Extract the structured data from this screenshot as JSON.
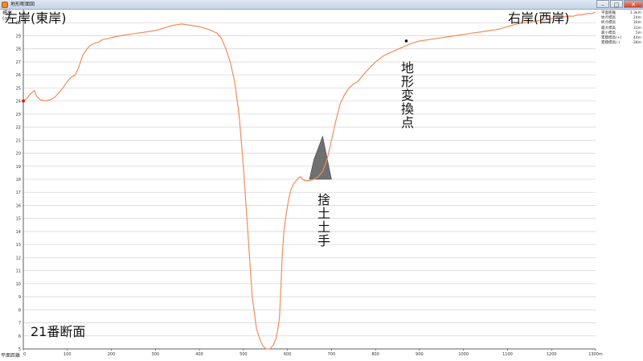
{
  "window": {
    "title": "地形断面図",
    "min_label": "–",
    "max_label": "□",
    "close_label": "✕"
  },
  "y_axis_title": "標高\n(m)",
  "x_axis_title": "平面距離",
  "legend": [
    {
      "label": "平面距離",
      "value": "1.3km"
    },
    {
      "label": "始点標高",
      "value": "24m"
    },
    {
      "label": "終点標高",
      "value": "30m"
    },
    {
      "label": "最大標高",
      "value": "31m"
    },
    {
      "label": "最小標高",
      "value": "5m"
    },
    {
      "label": "累積標高(+)",
      "value": "44m"
    },
    {
      "label": "累積標高(-)",
      "value": "-38m"
    }
  ],
  "annotations": {
    "left_bank": "左岸(東岸)",
    "right_bank": "右岸(西岸)",
    "terrain_change": "地形変換点",
    "embankment": "捨土土手",
    "section": "21番断面"
  },
  "colors": {
    "profile_line": "#f28c5a",
    "grid": "#d8d8d8",
    "embankment_fill": "#707070",
    "axis": "#333333"
  },
  "chart_data": {
    "type": "line",
    "xlabel": "平面距離",
    "ylabel": "標高(m)",
    "xlim": [
      0,
      1300
    ],
    "ylim": [
      5,
      31
    ],
    "grid": true,
    "x_ticks": [
      0,
      100,
      200,
      300,
      400,
      500,
      600,
      700,
      800,
      900,
      1000,
      1100,
      1200,
      "1300m"
    ],
    "y_ticks": [
      5,
      6,
      7,
      8,
      9,
      10,
      11,
      12,
      13,
      14,
      15,
      16,
      17,
      18,
      19,
      20,
      21,
      22,
      23,
      24,
      25,
      26,
      27,
      28,
      29,
      30
    ],
    "series": [
      {
        "x": [
          0,
          8,
          15,
          25,
          30,
          38,
          50,
          62,
          72,
          80,
          90,
          100,
          108,
          118,
          125,
          135,
          145,
          150,
          160,
          170,
          180,
          195,
          205,
          220,
          240,
          260,
          280,
          300,
          320,
          340,
          360,
          380,
          400,
          420,
          440,
          450,
          460,
          470,
          480,
          490,
          500,
          510,
          520,
          530,
          540,
          545,
          552,
          560,
          568,
          574,
          578,
          582,
          585,
          588,
          592,
          598,
          603,
          608,
          612,
          615,
          620,
          625,
          630,
          635,
          640,
          645,
          650,
          660,
          670,
          680,
          690,
          700,
          710,
          720,
          730,
          740,
          750,
          760,
          770,
          780,
          800,
          820,
          840,
          860,
          880,
          900,
          920,
          940,
          960,
          980,
          1000,
          1020,
          1040,
          1060,
          1080,
          1100,
          1120,
          1140,
          1160,
          1180,
          1200,
          1220,
          1240,
          1250,
          1260,
          1270,
          1280,
          1290,
          1300
        ],
        "values": [
          24.0,
          24.2,
          24.5,
          24.8,
          24.4,
          24.1,
          24.0,
          24.1,
          24.3,
          24.6,
          25.0,
          25.5,
          25.8,
          26.0,
          26.5,
          27.5,
          28.0,
          28.2,
          28.4,
          28.5,
          28.7,
          28.8,
          28.9,
          29.0,
          29.1,
          29.2,
          29.3,
          29.4,
          29.6,
          29.8,
          29.9,
          29.8,
          29.7,
          29.5,
          29.2,
          28.8,
          28.0,
          27.0,
          25.5,
          23.0,
          19.0,
          14.0,
          9.0,
          6.5,
          5.5,
          5.2,
          5.0,
          5.0,
          5.3,
          5.8,
          6.5,
          7.5,
          9.5,
          12.0,
          14.0,
          15.5,
          16.5,
          17.2,
          17.5,
          17.7,
          17.9,
          18.1,
          18.2,
          18.0,
          17.9,
          17.9,
          17.9,
          18.0,
          18.2,
          18.6,
          19.5,
          21.0,
          22.5,
          23.8,
          24.5,
          25.0,
          25.3,
          25.5,
          25.9,
          26.3,
          27.0,
          27.5,
          27.8,
          28.1,
          28.4,
          28.6,
          28.7,
          28.8,
          28.9,
          29.0,
          29.1,
          29.2,
          29.3,
          29.4,
          29.5,
          29.7,
          29.9,
          30.0,
          30.1,
          30.2,
          30.3,
          30.4,
          30.5,
          30.5,
          30.6,
          30.6,
          30.7,
          30.7,
          30.8
        ]
      }
    ]
  }
}
